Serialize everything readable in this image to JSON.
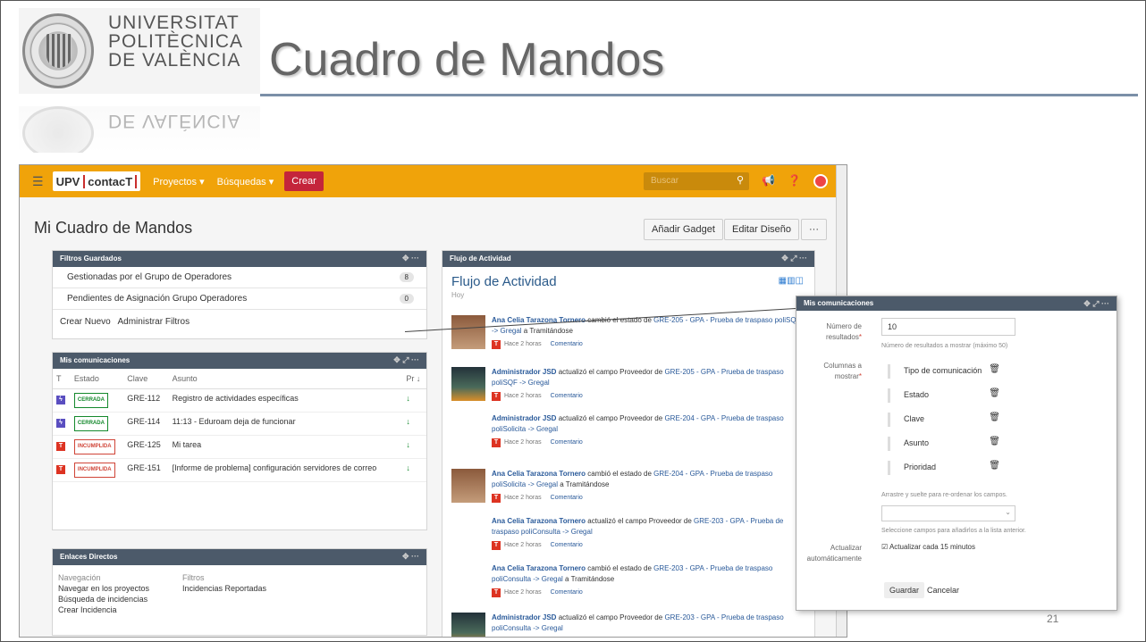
{
  "slide": {
    "title": "Cuadro de Mandos",
    "page_number": "21",
    "logo_lines": [
      "UNIVERSITAT",
      "POLITÈCNICA",
      "DE VALÈNCIA"
    ],
    "logo_reflection": "DE VALÈNCIA"
  },
  "app": {
    "brand_left": "UPV",
    "brand_right": "contacT",
    "nav": {
      "proyectos": "Proyectos ▾",
      "busquedas": "Búsquedas ▾",
      "crear": "Crear"
    },
    "search_placeholder": "Buscar",
    "page_title": "Mi Cuadro de Mandos",
    "buttons": {
      "add_gadget": "Añadir Gadget",
      "edit_layout": "Editar Diseño",
      "more": "···"
    }
  },
  "filtros": {
    "title": "Filtros Guardados",
    "items": [
      {
        "label": "Gestionadas por el Grupo de Operadores",
        "count": "8"
      },
      {
        "label": "Pendientes de Asignación Grupo Operadores",
        "count": "0"
      }
    ],
    "links": {
      "new": "Crear Nuevo",
      "manage": "Administrar Filtros"
    }
  },
  "comunicaciones": {
    "title": "Mis comunicaciones",
    "headers": {
      "t": "T",
      "estado": "Estado",
      "clave": "Clave",
      "asunto": "Asunto",
      "pr": "Pr ↓"
    },
    "rows": [
      {
        "type": "lz",
        "status": "CERRADA",
        "status_class": "green",
        "key": "GRE-112",
        "summary": "Registro de actividades específicas"
      },
      {
        "type": "lz",
        "status": "CERRADA",
        "status_class": "green",
        "key": "GRE-114",
        "summary": "11:13 - Eduroam deja de funcionar"
      },
      {
        "type": "lr",
        "status": "INCUMPLIDA",
        "status_class": "red",
        "key": "GRE-125",
        "summary": "Mi tarea"
      },
      {
        "type": "lr",
        "status": "INCUMPLIDA",
        "status_class": "red",
        "key": "GRE-151",
        "summary": "[Informe de problema] configuración servidores de correo"
      }
    ]
  },
  "enlaces": {
    "title": "Enlaces Directos",
    "nav_header": "Navegación",
    "nav_items": [
      "Navegar en los proyectos",
      "Búsqueda de incidencias",
      "Crear Incidencia"
    ],
    "filter_header": "Filtros",
    "filter_items": [
      "Incidencias Reportadas"
    ]
  },
  "actividad": {
    "header": "Flujo de Actividad",
    "title": "Flujo de Actividad",
    "day": "Hoy",
    "entries": [
      {
        "user": "Ana Celia Tarazona Tornero",
        "action": " cambió el estado de ",
        "link": "GRE-205 - GPA - Prueba de traspaso poliSQF -> Gregal",
        "tail": " a Tramitándose",
        "time": "Hace 2 horas",
        "comment": "Comentario"
      },
      {
        "user": "Administrador JSD",
        "action": " actualizó el campo Proveedor de ",
        "link": "GRE-205 - GPA - Prueba de traspaso poliSQF -> Gregal",
        "tail": "",
        "time": "Hace 2 horas",
        "comment": "Comentario"
      },
      {
        "user": "Administrador JSD",
        "action": " actualizó el campo Proveedor de ",
        "link": "GRE-204 - GPA - Prueba de traspaso poliSolicita -> Gregal",
        "tail": "",
        "time": "Hace 2 horas",
        "comment": "Comentario"
      },
      {
        "user": "Ana Celia Tarazona Tornero",
        "action": " cambió el estado de ",
        "link": "GRE-204 - GPA - Prueba de traspaso poliSolicita -> Gregal",
        "tail": " a Tramitándose",
        "time": "Hace 2 horas",
        "comment": "Comentario"
      },
      {
        "user": "Ana Celia Tarazona Tornero",
        "action": " actualizó el campo Proveedor de ",
        "link": "GRE-203 - GPA - Prueba de traspaso poliConsulta -> Gregal",
        "tail": "",
        "time": "Hace 2 horas",
        "comment": "Comentario"
      },
      {
        "user": "Ana Celia Tarazona Tornero",
        "action": " cambió el estado de ",
        "link": "GRE-203 - GPA - Prueba de traspaso poliConsulta -> Gregal",
        "tail": " a Tramitándose",
        "time": "Hace 2 horas",
        "comment": "Comentario"
      },
      {
        "user": "Administrador JSD",
        "action": " actualizó el campo Proveedor de ",
        "link": "GRE-203 - GPA - Prueba de traspaso poliConsulta -> Gregal",
        "tail": "",
        "time": "",
        "comment": ""
      }
    ]
  },
  "popup": {
    "title": "Mis comunicaciones",
    "results_label": "Número de resultados",
    "results_value": "10",
    "results_help": "Número de resultados a mostrar (máximo 50)",
    "columns_label": "Columnas a mostrar",
    "columns": [
      "Tipo de comunicación",
      "Estado",
      "Clave",
      "Asunto",
      "Prioridad"
    ],
    "drag_help": "Arrastre y suelte para re-ordenar los campos.",
    "add_help": "Seleccione campos para añadirlos a la lista anterior.",
    "refresh_label": "Actualizar automáticamente",
    "refresh_checkbox": "Actualizar cada 15 minutos",
    "save": "Guardar",
    "cancel": "Cancelar"
  }
}
